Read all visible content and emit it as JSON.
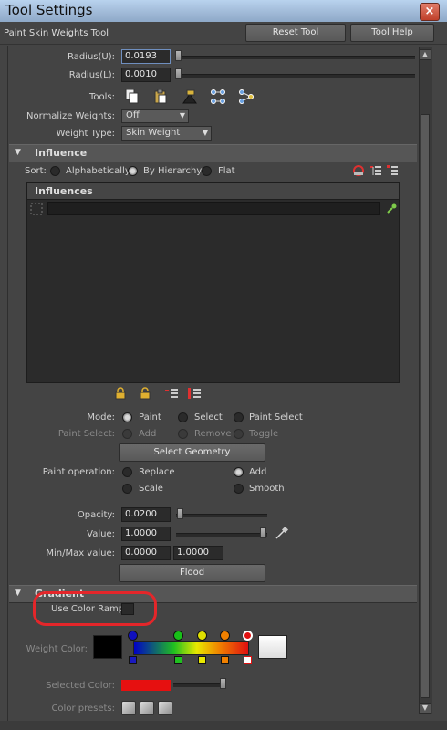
{
  "window": {
    "title": "Tool Settings",
    "close_glyph": "×"
  },
  "header": {
    "tool_name": "Paint Skin Weights Tool",
    "reset_label": "Reset Tool",
    "help_label": "Tool Help"
  },
  "brush": {
    "radius_u_label": "Radius(U):",
    "radius_u_value": "0.0193",
    "radius_l_label": "Radius(L):",
    "radius_l_value": "0.0010",
    "tools_label": "Tools:",
    "tool_icons": [
      "copy-icon",
      "paste-icon",
      "weight-hammer-icon",
      "move-weights-icon",
      "show-influences-icon"
    ],
    "normalize_label": "Normalize Weights:",
    "normalize_value": "Off",
    "weight_type_label": "Weight Type:",
    "weight_type_value": "Skin Weight"
  },
  "influence": {
    "section_title": "Influence",
    "sort_label": "Sort:",
    "sort_options": [
      "Alphabetically",
      "By Hierarchy",
      "Flat"
    ],
    "sort_selected": "By Hierarchy",
    "list_title": "Influences",
    "list_items": [],
    "lock_icons": [
      "lock-selected-icon",
      "unlock-selected-icon",
      "expand-list-icon",
      "collapse-list-icon"
    ]
  },
  "mode": {
    "label": "Mode:",
    "options": [
      "Paint",
      "Select",
      "Paint Select"
    ],
    "selected": "Paint",
    "paint_select_label": "Paint Select:",
    "paint_select_options": [
      "Add",
      "Remove",
      "Toggle"
    ],
    "select_geometry_label": "Select Geometry"
  },
  "paint_operation": {
    "label": "Paint operation:",
    "options": [
      "Replace",
      "Add",
      "Scale",
      "Smooth"
    ],
    "selected": "Add"
  },
  "values": {
    "opacity_label": "Opacity:",
    "opacity_value": "0.0200",
    "value_label": "Value:",
    "value_value": "1.0000",
    "minmax_label": "Min/Max value:",
    "min_value": "0.0000",
    "max_value": "1.0000",
    "flood_label": "Flood"
  },
  "gradient": {
    "section_title": "Gradient",
    "use_color_ramp_label": "Use Color Ramp",
    "weight_color_label": "Weight Color:",
    "selected_color_label": "Selected Color:",
    "color_presets_label": "Color presets:",
    "marker_colors": [
      "#1010c0",
      "#18c018",
      "#e0e000",
      "#f08000",
      "#e01010"
    ],
    "selected_color": "#e61010"
  },
  "colors": {
    "panel_bg": "#444444",
    "field_bg": "#2b2b2b",
    "annotation_red": "#e4262a"
  }
}
